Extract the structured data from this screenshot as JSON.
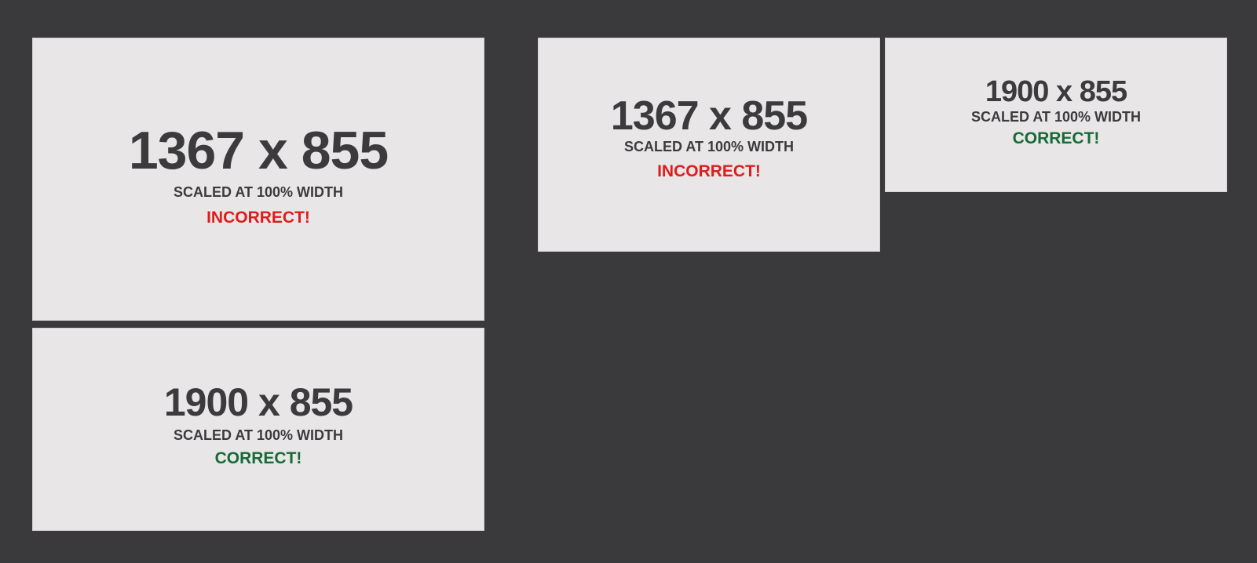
{
  "panels": [
    {
      "dimensions": "1367 x 855",
      "scale_text": "SCALED AT 100% WIDTH",
      "verdict": "INCORRECT!",
      "verdict_color": "#e01b1b"
    },
    {
      "dimensions": "1900 x 855",
      "scale_text": "SCALED AT 100% WIDTH",
      "verdict": "CORRECT!",
      "verdict_color": "#176a38"
    },
    {
      "dimensions": "1367 x 855",
      "scale_text": "SCALED AT 100% WIDTH",
      "verdict": "INCORRECT!",
      "verdict_color": "#e01b1b"
    },
    {
      "dimensions": "1900 x 855",
      "scale_text": "SCALED AT 100% WIDTH",
      "verdict": "CORRECT!",
      "verdict_color": "#176a38"
    }
  ],
  "colors": {
    "background": "#3a3a3c",
    "panel": "#e8e6e7",
    "text": "#3b3b3d"
  }
}
